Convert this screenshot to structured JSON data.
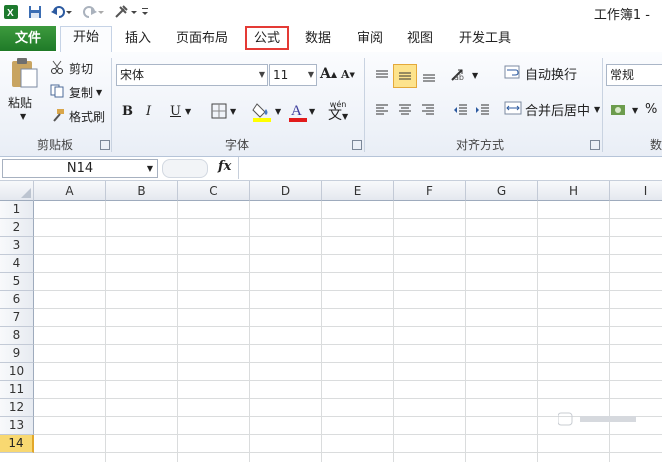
{
  "app_title": "工作簿1 -",
  "tabs": {
    "file": "文件",
    "home": "开始",
    "insert": "插入",
    "page_layout": "页面布局",
    "formulas": "公式",
    "data": "数据",
    "review": "审阅",
    "view": "视图",
    "developer": "开发工具"
  },
  "clipboard": {
    "paste": "粘贴",
    "cut": "剪切",
    "copy": "复制",
    "format_painter": "格式刷",
    "label": "剪贴板"
  },
  "font": {
    "name": "宋体",
    "size": "11",
    "bold": "B",
    "italic": "I",
    "underline": "U",
    "label": "字体",
    "phonetic": "wén"
  },
  "alignment": {
    "wrap_text": "自动换行",
    "merge_center": "合并后居中",
    "label": "对齐方式"
  },
  "number": {
    "format": "常规",
    "percent": "%",
    "label_partial": "数"
  },
  "formula_bar": {
    "name_box": "N14",
    "fx": "fx"
  },
  "grid": {
    "columns": [
      "A",
      "B",
      "C",
      "D",
      "E",
      "F",
      "G",
      "H",
      "I"
    ],
    "rows": [
      "1",
      "2",
      "3",
      "4",
      "5",
      "6",
      "7",
      "8",
      "9",
      "10",
      "11",
      "12",
      "13",
      "14"
    ],
    "selected_row": "14"
  },
  "colors": {
    "file_tab": "#2a8a32",
    "highlight_box": "#e43a35",
    "selected_row": "#f8d871"
  }
}
